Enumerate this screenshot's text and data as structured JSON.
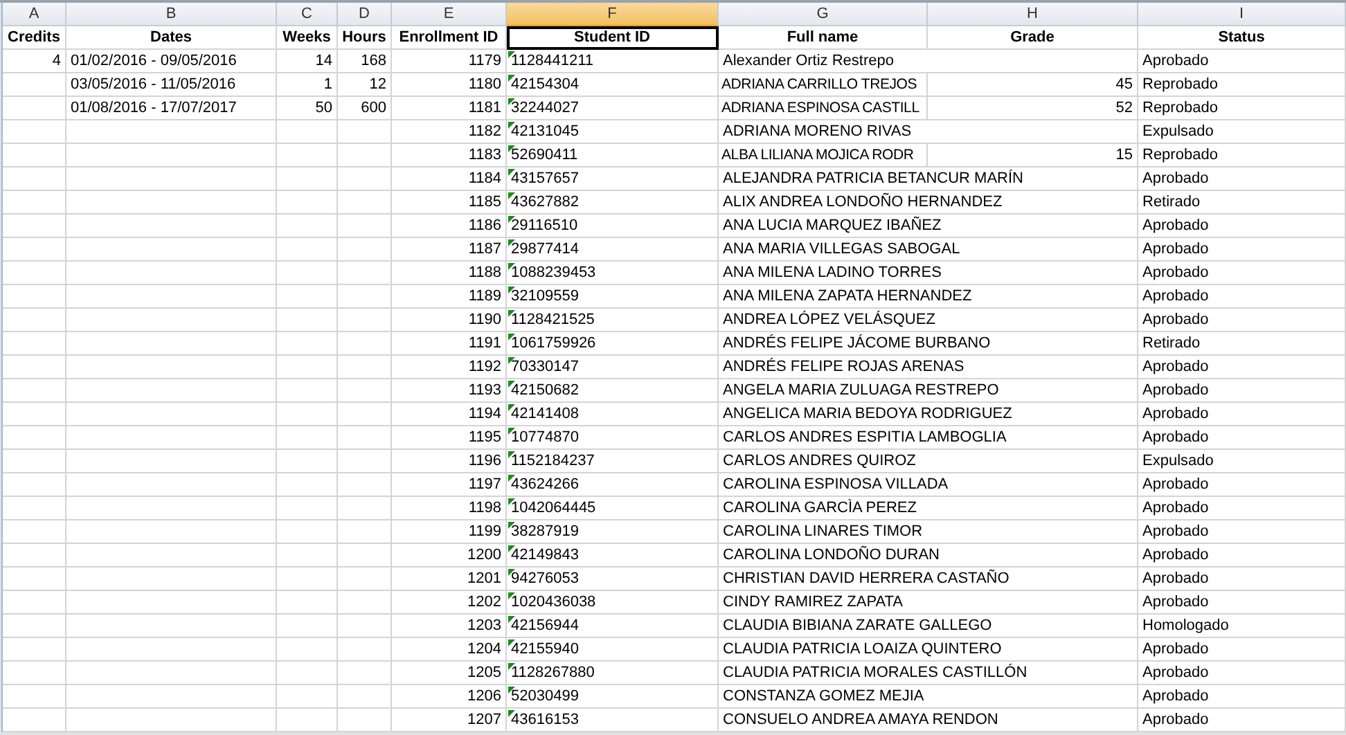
{
  "column_letters": [
    {
      "label": "A",
      "selected": false
    },
    {
      "label": "B",
      "selected": false
    },
    {
      "label": "C",
      "selected": false
    },
    {
      "label": "D",
      "selected": false
    },
    {
      "label": "E",
      "selected": false
    },
    {
      "label": "F",
      "selected": true
    },
    {
      "label": "G",
      "selected": false
    },
    {
      "label": "H",
      "selected": false
    },
    {
      "label": "I",
      "selected": false
    }
  ],
  "headers": [
    {
      "label": "Credits",
      "selected": false
    },
    {
      "label": "Dates",
      "selected": false
    },
    {
      "label": "Weeks",
      "selected": false
    },
    {
      "label": "Hours",
      "selected": false
    },
    {
      "label": "Enrollment ID",
      "selected": false
    },
    {
      "label": "Student ID",
      "selected": true
    },
    {
      "label": "Full name",
      "selected": false
    },
    {
      "label": "Grade",
      "selected": false
    },
    {
      "label": "Status",
      "selected": false
    }
  ],
  "rows": [
    {
      "credits": "4",
      "dates": "01/02/2016 - 09/05/2016",
      "weeks": "14",
      "hours": "168",
      "enrollment_id": "1179",
      "student_id": "1128441211",
      "flagged": true,
      "name": "Alexander  Ortiz Restrepo",
      "status": "Aprobado"
    },
    {
      "dates": "03/05/2016 - 11/05/2016",
      "weeks": "1",
      "hours": "12",
      "enrollment_id": "1180",
      "student_id": "42154304",
      "flagged": true,
      "name": "ADRIANA CARRILLO TREJOS",
      "grade": "45",
      "status": "Reprobado"
    },
    {
      "dates": "01/08/2016 - 17/07/2017",
      "weeks": "50",
      "hours": "600",
      "enrollment_id": "1181",
      "student_id": "32244027",
      "flagged": true,
      "name": "ADRIANA ESPINOSA CASTILL",
      "grade": "52",
      "status": "Reprobado"
    },
    {
      "enrollment_id": "1182",
      "student_id": "42131045",
      "flagged": true,
      "name": "ADRIANA MORENO RIVAS",
      "status": "Expulsado"
    },
    {
      "enrollment_id": "1183",
      "student_id": "52690411",
      "flagged": true,
      "name": "ALBA LILIANA MOJICA RODR",
      "grade": "15",
      "status": "Reprobado"
    },
    {
      "enrollment_id": "1184",
      "student_id": "43157657",
      "flagged": true,
      "name": "ALEJANDRA PATRICIA BETANCUR MARÍN",
      "status": "Aprobado"
    },
    {
      "enrollment_id": "1185",
      "student_id": "43627882",
      "flagged": true,
      "name": "ALIX ANDREA LONDOÑO HERNANDEZ",
      "status": "Retirado"
    },
    {
      "enrollment_id": "1186",
      "student_id": "29116510",
      "flagged": true,
      "name": "ANA LUCIA MARQUEZ IBAÑEZ",
      "status": "Aprobado"
    },
    {
      "enrollment_id": "1187",
      "student_id": "29877414",
      "flagged": true,
      "name": "ANA MARIA VILLEGAS SABOGAL",
      "status": "Aprobado"
    },
    {
      "enrollment_id": "1188",
      "student_id": "1088239453",
      "flagged": true,
      "name": "ANA MILENA LADINO TORRES",
      "status": "Aprobado"
    },
    {
      "enrollment_id": "1189",
      "student_id": "32109559",
      "flagged": true,
      "name": "ANA MILENA ZAPATA HERNANDEZ",
      "status": "Aprobado"
    },
    {
      "enrollment_id": "1190",
      "student_id": "1128421525",
      "flagged": true,
      "name": "ANDREA LÓPEZ VELÁSQUEZ",
      "status": "Aprobado"
    },
    {
      "enrollment_id": "1191",
      "student_id": "1061759926",
      "flagged": true,
      "name": "ANDRÉS FELIPE JÁCOME BURBANO",
      "status": "Retirado"
    },
    {
      "enrollment_id": "1192",
      "student_id": "70330147",
      "flagged": true,
      "name": "ANDRÉS FELIPE ROJAS ARENAS",
      "status": "Aprobado"
    },
    {
      "enrollment_id": "1193",
      "student_id": "42150682",
      "flagged": true,
      "name": "ANGELA MARIA ZULUAGA RESTREPO",
      "status": "Aprobado"
    },
    {
      "enrollment_id": "1194",
      "student_id": "42141408",
      "flagged": true,
      "name": "ANGELICA MARIA BEDOYA RODRIGUEZ",
      "status": "Aprobado"
    },
    {
      "enrollment_id": "1195",
      "student_id": "10774870",
      "flagged": true,
      "name": "CARLOS ANDRES ESPITIA LAMBOGLIA",
      "status": "Aprobado"
    },
    {
      "enrollment_id": "1196",
      "student_id": "1152184237",
      "flagged": true,
      "name": "CARLOS ANDRES QUIROZ",
      "status": "Expulsado"
    },
    {
      "enrollment_id": "1197",
      "student_id": "43624266",
      "flagged": true,
      "name": "CAROLINA ESPINOSA VILLADA",
      "status": "Aprobado"
    },
    {
      "enrollment_id": "1198",
      "student_id": "1042064445",
      "flagged": true,
      "name": "CAROLINA GARCÌA PEREZ",
      "status": "Aprobado"
    },
    {
      "enrollment_id": "1199",
      "student_id": "38287919",
      "flagged": true,
      "name": "CAROLINA LINARES TIMOR",
      "status": "Aprobado"
    },
    {
      "enrollment_id": "1200",
      "student_id": "42149843",
      "flagged": true,
      "name": "CAROLINA LONDOÑO DURAN",
      "status": "Aprobado"
    },
    {
      "enrollment_id": "1201",
      "student_id": "94276053",
      "flagged": true,
      "name": "CHRISTIAN DAVID HERRERA CASTAÑO",
      "status": "Aprobado"
    },
    {
      "enrollment_id": "1202",
      "student_id": "1020436038",
      "flagged": true,
      "name": "CINDY RAMIREZ ZAPATA",
      "status": "Aprobado"
    },
    {
      "enrollment_id": "1203",
      "student_id": "42156944",
      "flagged": true,
      "name": "CLAUDIA BIBIANA ZARATE GALLEGO",
      "status": "Homologado"
    },
    {
      "enrollment_id": "1204",
      "student_id": "42155940",
      "flagged": true,
      "name": "CLAUDIA PATRICIA LOAIZA QUINTERO",
      "status": "Aprobado"
    },
    {
      "enrollment_id": "1205",
      "student_id": "1128267880",
      "flagged": true,
      "name": "CLAUDIA PATRICIA MORALES CASTILLÓN",
      "status": "Aprobado"
    },
    {
      "enrollment_id": "1206",
      "student_id": "52030499",
      "flagged": true,
      "name": "CONSTANZA GOMEZ MEJIA",
      "status": "Aprobado"
    },
    {
      "enrollment_id": "1207",
      "student_id": "43616153",
      "flagged": true,
      "name": "CONSUELO ANDREA AMAYA RENDON",
      "status": "Aprobado"
    }
  ]
}
